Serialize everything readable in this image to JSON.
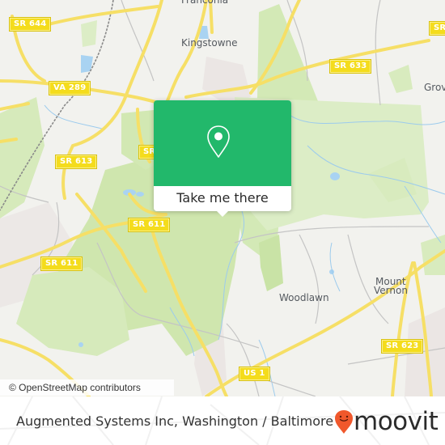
{
  "map": {
    "attribution": "© OpenStreetMap contributors",
    "colors": {
      "land": "#f2f2ee",
      "park": "#cfe8b0",
      "park_light": "#dcedc6",
      "road_major": "#f6e06a",
      "road_minor": "#bfbfbf",
      "water": "#a8d2f0",
      "shield": "#f4dc1c"
    },
    "route_shields": [
      {
        "id": "sr-644",
        "label": "SR 644"
      },
      {
        "id": "va-289",
        "label": "VA 289"
      },
      {
        "id": "sr-633",
        "label": "SR 633"
      },
      {
        "id": "sr-613",
        "label": "SR 613"
      },
      {
        "id": "sr-partial",
        "label": "SR"
      },
      {
        "id": "sr-611-a",
        "label": "SR 611"
      },
      {
        "id": "sr-611-b",
        "label": "SR 611"
      },
      {
        "id": "sr-623",
        "label": "SR 623"
      },
      {
        "id": "us-1",
        "label": "US 1"
      },
      {
        "id": "sr-right",
        "label": "SR"
      }
    ],
    "places": [
      {
        "id": "franconia",
        "label": "Franconia"
      },
      {
        "id": "kingstowne",
        "label": "Kingstowne"
      },
      {
        "id": "grov",
        "label": "Grov"
      },
      {
        "id": "woodlawn",
        "label": "Woodlawn"
      },
      {
        "id": "mount-vernon-1",
        "label": "Mount"
      },
      {
        "id": "mount-vernon-2",
        "label": "Vernon"
      }
    ]
  },
  "popup": {
    "icon": "map-pin-icon",
    "cta_label": "Take me there",
    "accent": "#22b86b"
  },
  "footer": {
    "title": "Augmented Systems Inc, Washington / Baltimore",
    "brand": "moovit",
    "brand_icon": "moovit-smiley-pin-icon",
    "brand_color": "#f0582c"
  }
}
